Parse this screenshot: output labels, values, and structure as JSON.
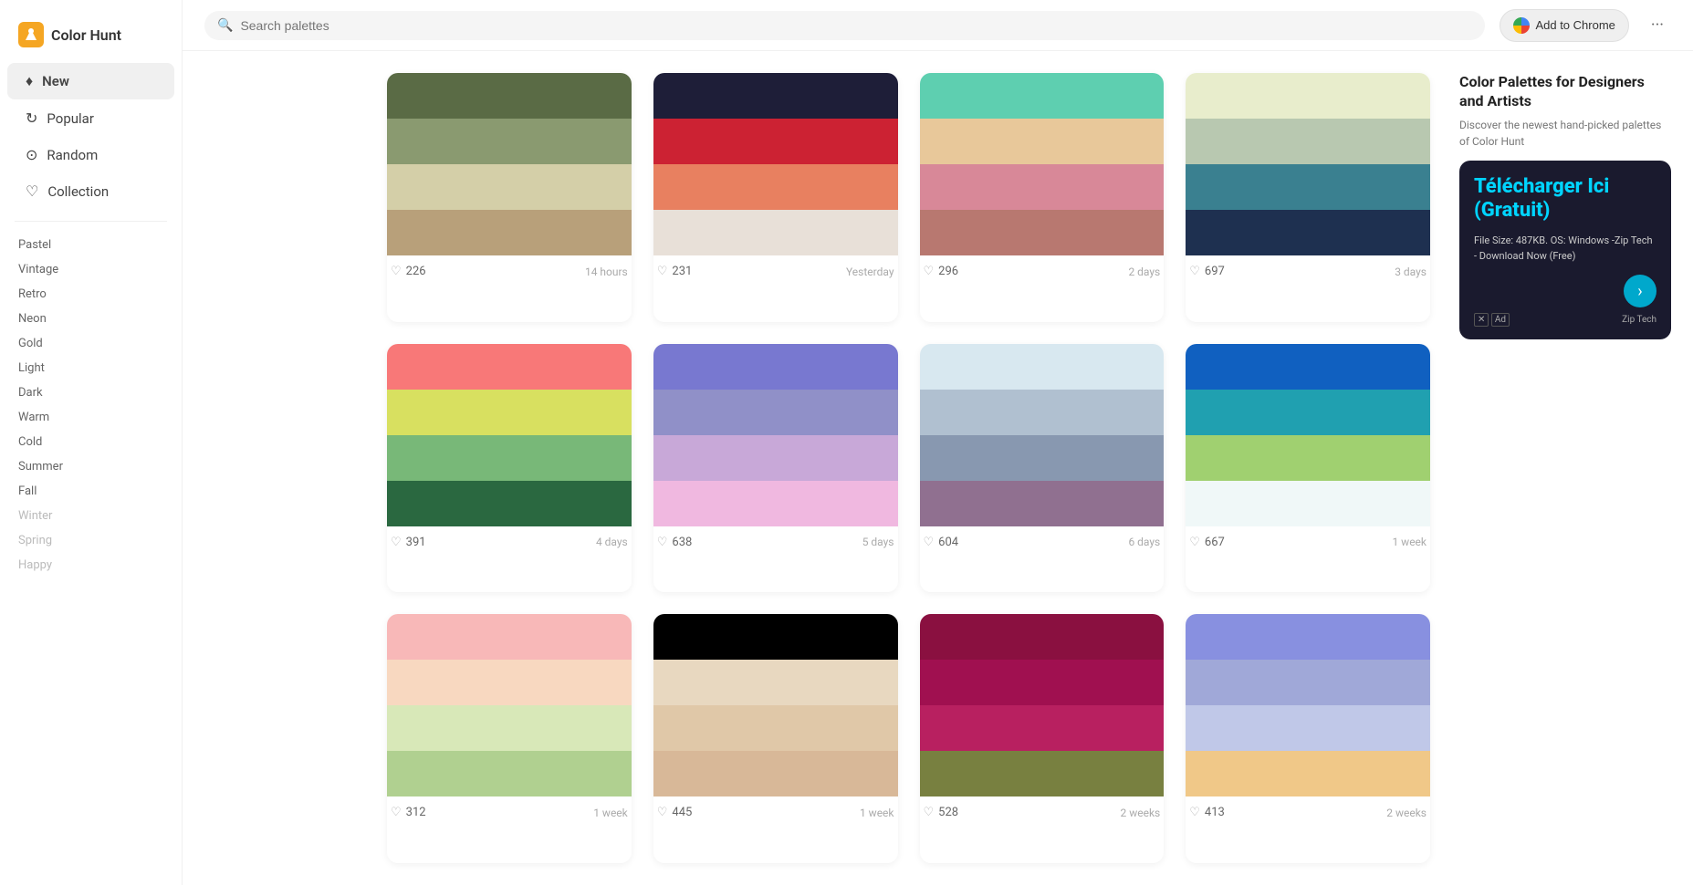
{
  "sidebar": {
    "logo": "Color Hunt",
    "nav": [
      {
        "id": "new",
        "label": "New",
        "icon": "♦",
        "active": true
      },
      {
        "id": "popular",
        "label": "Popular",
        "icon": "↻"
      },
      {
        "id": "random",
        "label": "Random",
        "icon": "⊙"
      },
      {
        "id": "collection",
        "label": "Collection",
        "icon": "♡"
      }
    ],
    "tags": [
      {
        "label": "Pastel",
        "muted": false
      },
      {
        "label": "Vintage",
        "muted": false
      },
      {
        "label": "Retro",
        "muted": false
      },
      {
        "label": "Neon",
        "muted": false
      },
      {
        "label": "Gold",
        "muted": false
      },
      {
        "label": "Light",
        "muted": false
      },
      {
        "label": "Dark",
        "muted": false
      },
      {
        "label": "Warm",
        "muted": false
      },
      {
        "label": "Cold",
        "muted": false
      },
      {
        "label": "Summer",
        "muted": false
      },
      {
        "label": "Fall",
        "muted": false
      },
      {
        "label": "Winter",
        "muted": true
      },
      {
        "label": "Spring",
        "muted": true
      },
      {
        "label": "Happy",
        "muted": true
      }
    ]
  },
  "topbar": {
    "search_placeholder": "Search palettes",
    "chrome_btn": "Add to Chrome",
    "dots": "···"
  },
  "palettes": [
    {
      "colors": [
        "#5a6b45",
        "#8a9a70",
        "#d4cfa8",
        "#b8a07a"
      ],
      "likes": 226,
      "time": "14 hours"
    },
    {
      "colors": [
        "#1e1e38",
        "#cc2233",
        "#e88060",
        "#e8e0d8"
      ],
      "likes": 231,
      "time": "Yesterday"
    },
    {
      "colors": [
        "#5ecfb0",
        "#e8c89a",
        "#d88898",
        "#b87870"
      ],
      "likes": 296,
      "time": "2 days"
    },
    {
      "colors": [
        "#e8edcc",
        "#b8c8b0",
        "#3a8090",
        "#1e3050"
      ],
      "likes": 697,
      "time": "3 days"
    },
    {
      "colors": [
        "#f87878",
        "#d8e060",
        "#78b878",
        "#2a6840"
      ],
      "likes": 391,
      "time": "4 days"
    },
    {
      "colors": [
        "#7878d0",
        "#9090c8",
        "#c8a8d8",
        "#f0b8e0"
      ],
      "likes": 638,
      "time": "5 days"
    },
    {
      "colors": [
        "#d8e8f0",
        "#b0c0d0",
        "#8898b0",
        "#907090"
      ],
      "likes": 604,
      "time": "6 days"
    },
    {
      "colors": [
        "#1060c0",
        "#20a0b0",
        "#a0d070",
        "#f0f8f8"
      ],
      "likes": 667,
      "time": "1 week"
    },
    {
      "colors": [
        "#f8b8b8",
        "#f8d8c0",
        "#d8e8b8",
        "#b0d090"
      ],
      "likes": 312,
      "time": "1 week"
    },
    {
      "colors": [
        "#000000",
        "#e8d8c0",
        "#e0c8a8",
        "#d8b898"
      ],
      "likes": 445,
      "time": "1 week"
    },
    {
      "colors": [
        "#8a1040",
        "#a01050",
        "#b82060",
        "#788040"
      ],
      "likes": 528,
      "time": "2 weeks"
    },
    {
      "colors": [
        "#8890e0",
        "#a0a8d8",
        "#c0c8e8",
        "#f0c888"
      ],
      "likes": 413,
      "time": "2 weeks"
    }
  ],
  "right_panel": {
    "title": "Color Palettes for Designers and Artists",
    "desc": "Discover the newest hand-picked palettes of Color Hunt",
    "ad": {
      "title": "Télécharger Ici (Gratuit)",
      "desc": "File Size: 487KB. OS: Windows -Zip Tech - Download Now (Free)",
      "provider": "Zip Tech",
      "badge_x": "✕",
      "badge_ad": "Ad"
    }
  }
}
